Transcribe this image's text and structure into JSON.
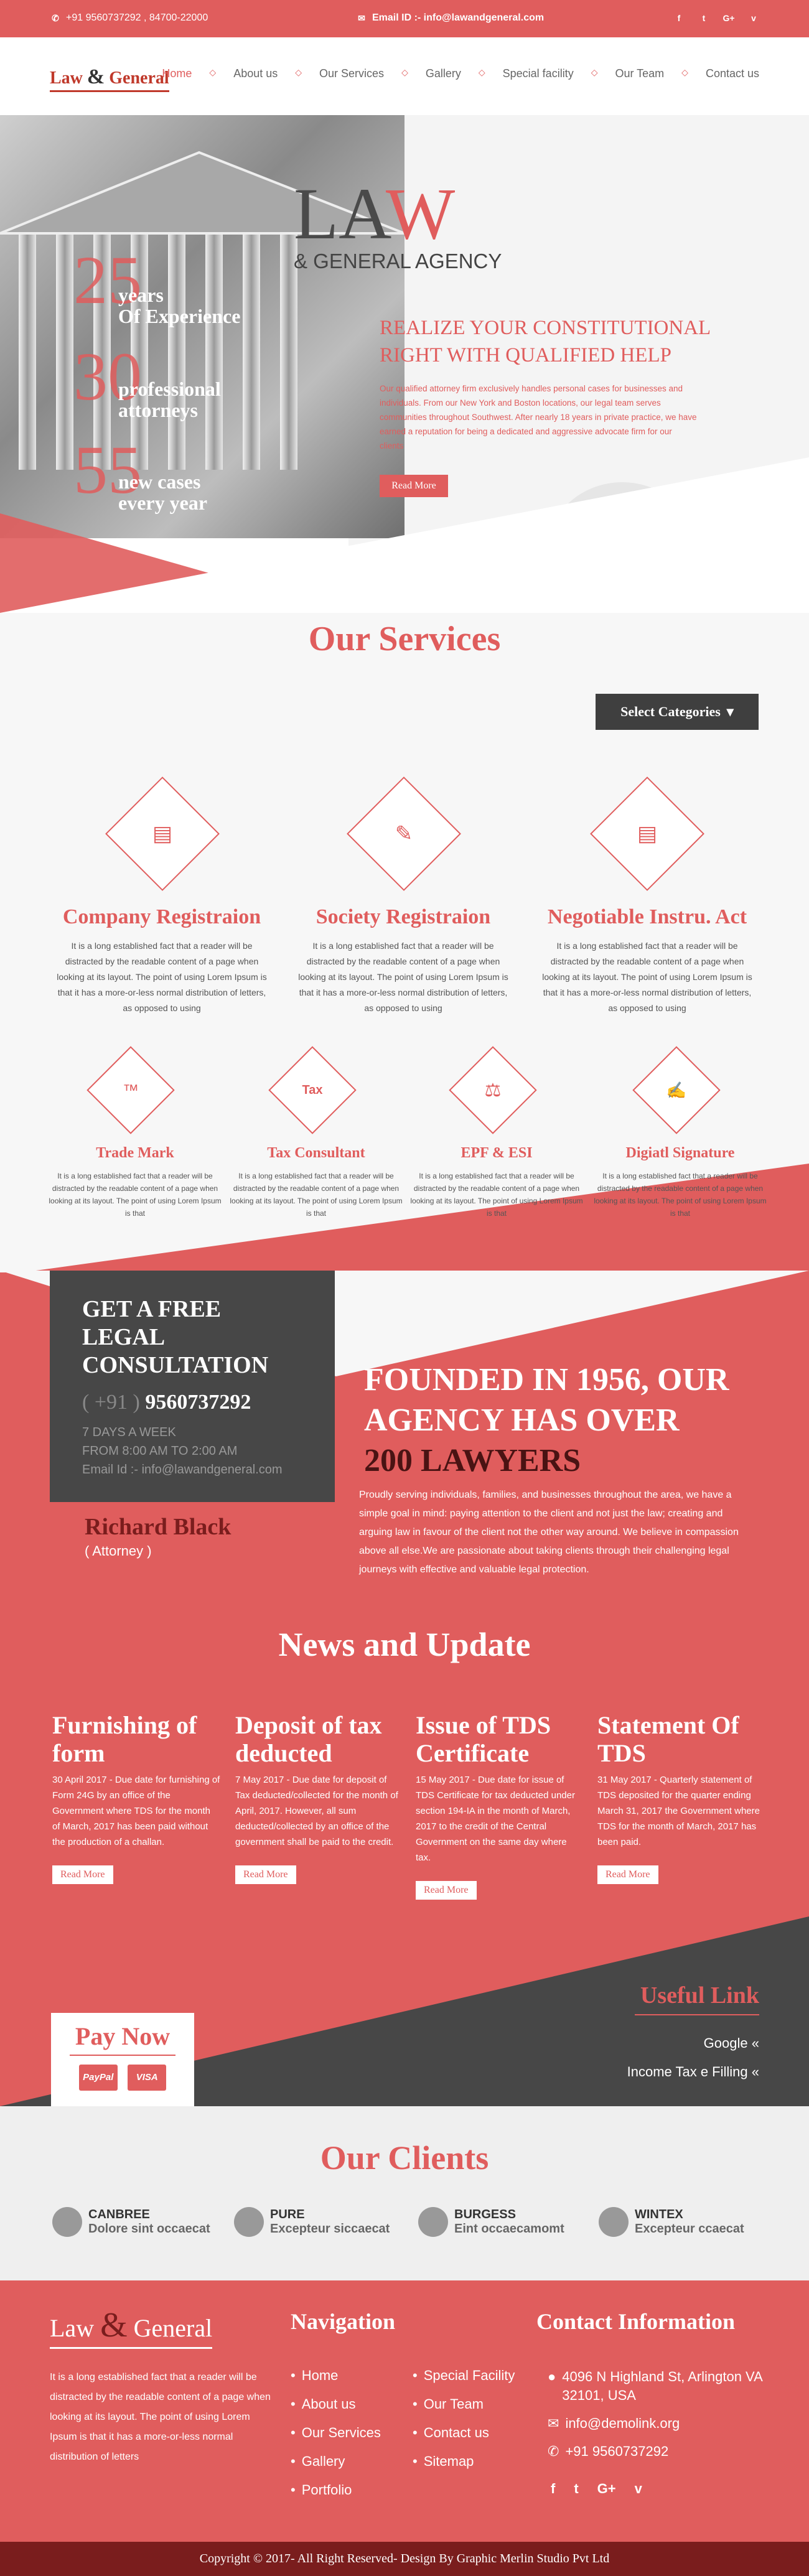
{
  "topbar": {
    "phone": "+91 9560737292 , 84700-22000",
    "email": "Email ID :- info@lawandgeneral.com",
    "social": [
      "f",
      "t",
      "G+",
      "v"
    ]
  },
  "nav": {
    "logo_left": "Law",
    "logo_amp": "&",
    "logo_right": "General",
    "items": [
      "Home",
      "About us",
      "Our Services",
      "Gallery",
      "Special facility",
      "Our Team",
      "Contact us"
    ]
  },
  "hero": {
    "title_law_1": "LA",
    "title_law_2": "W",
    "subtitle": "& GENERAL AGENCY",
    "stats": [
      {
        "num": "25",
        "text1": "years",
        "text2": "Of Experience"
      },
      {
        "num": "30",
        "text1": "professional",
        "text2": "attorneys"
      },
      {
        "num": "55",
        "text1": "new cases",
        "text2": "every year"
      }
    ],
    "headline": "REALIZE YOUR CONSTITUTIONAL RIGHT WITH QUALIFIED HELP",
    "paragraph": "Our qualified attorney firm exclusively handles personal cases for businesses and individuals. From our New York and Boston locations, our legal team serves communities throughout Southwest. After nearly 18 years in private practice, we have earned a reputation for being a dedicated and aggressive advocate firm for our clients",
    "button": "Read More"
  },
  "services": {
    "title": "Our Services",
    "select_label": "Select Categories",
    "big": [
      {
        "title": "Company Registraion",
        "desc": "It is a long established fact that a reader will be distracted by the readable content of a page when looking at its layout. The point of using Lorem Ipsum is that it has a more-or-less normal distribution of letters, as opposed to using",
        "icon": "document-icon"
      },
      {
        "title": "Society Registraion",
        "desc": "It is a long established fact that a reader will be distracted by the readable content of a page when looking at its layout. The point of using Lorem Ipsum is that it has a more-or-less normal distribution of letters, as opposed to using",
        "icon": "certificate-icon"
      },
      {
        "title": "Negotiable Instru. Act",
        "desc": "It is a long established fact that a reader will be distracted by the readable content of a page when looking at its layout. The point of using Lorem Ipsum is that it has a more-or-less normal distribution of letters, as opposed to using",
        "icon": "chart-search-icon"
      }
    ],
    "small": [
      {
        "title": "Trade Mark",
        "desc": "It is a long established fact that a reader will be distracted by the readable content of a page when looking at its layout. The point of using Lorem Ipsum is that",
        "icon": "trademark-icon"
      },
      {
        "title": "Tax Consultant",
        "desc": "It is a long established fact that a reader will be distracted by the readable content of a page when looking at its layout. The point of using Lorem Ipsum is that",
        "icon": "tax-icon"
      },
      {
        "title": "EPF & ESI",
        "desc": "It is a long established fact that a reader will be distracted by the readable content of a page when looking at its layout. The point of using Lorem Ipsum is that",
        "icon": "scales-icon"
      },
      {
        "title": "Digiatl Signature",
        "desc": "It is a long established fact that a reader will be distracted by the readable content of a page when looking at its layout. The point of using Lorem Ipsum is that",
        "icon": "signature-icon"
      }
    ]
  },
  "consult": {
    "heading": "GET A FREE LEGAL CONSULTATION",
    "phone_prefix": "( +91 )",
    "phone": "9560737292",
    "days": "7 DAYS A WEEK",
    "hours": "FROM 8:00 AM TO 2:00 AM",
    "email": "Email Id :- info@lawandgeneral.com",
    "attorney_name": "Richard Black",
    "attorney_role": "( Attorney )"
  },
  "founded": {
    "line1": "FOUNDED IN 1956, OUR AGENCY HAS OVER",
    "line2": "200 LAWYERS",
    "desc": "Proudly serving individuals, families, and businesses throughout the area, we have a simple goal in mind: paying attention to the client and not just the law; creating and arguing law in favour of the client not the other way around. We believe in compassion above all else.We are passionate about taking clients through their challenging legal journeys with effective and valuable legal protection."
  },
  "news": {
    "title": "News and Update",
    "items": [
      {
        "title": "Furnishing of form",
        "text": "30 April 2017 - Due date for furnishing of Form 24G by an office of the Government where TDS for the month of March, 2017 has been paid without the production of a challan.",
        "button": "Read More"
      },
      {
        "title": "Deposit of tax deducted",
        "text": "7 May 2017 - Due date for deposit of Tax deducted/collected for the month of April, 2017. However, all sum deducted/collected by an office of the government shall be paid to the credit.",
        "button": "Read More"
      },
      {
        "title": "Issue of TDS Certificate",
        "text": "15 May 2017 - Due date for issue of TDS Certificate for tax deducted under section 194-IA in the month of March, 2017 to the credit of the Central Government on the same day where tax.",
        "button": "Read More"
      },
      {
        "title": "Statement Of TDS",
        "text": "31 May 2017 - Quarterly statement of TDS deposited for the quarter ending March 31, 2017 the Government where TDS for the month of March, 2017 has been paid.",
        "button": "Read More"
      }
    ]
  },
  "pay": {
    "title": "Pay Now",
    "cards": [
      "PayPal",
      "VISA"
    ]
  },
  "useful": {
    "title": "Useful Link",
    "links": [
      "Google",
      "Income Tax e Filling"
    ]
  },
  "clients": {
    "title": "Our Clients",
    "items": [
      {
        "name": "CANBREE",
        "sub": "Dolore sint occaecat"
      },
      {
        "name": "PURE",
        "sub": "Excepteur siccaecat"
      },
      {
        "name": "BURGESS",
        "sub": "Eint occaecamomt"
      },
      {
        "name": "WINTEX",
        "sub": "Excepteur ccaecat"
      }
    ]
  },
  "footer": {
    "logo_left": "Law",
    "logo_amp": "&",
    "logo_right": "General",
    "text": "It is a long established fact that a reader will be distracted by the readable content of a page when looking at its layout. The point of using Lorem Ipsum is that it has a more-or-less normal distribution of letters",
    "nav_title": "Navigation",
    "nav_col1": [
      "Home",
      "About us",
      "Our Services",
      "Gallery",
      "Portfolio"
    ],
    "nav_col2": [
      "Special Facility",
      "Our Team",
      "Contact us",
      "Sitemap"
    ],
    "contact_title": "Contact Information",
    "address": "4096 N Highland St, Arlington VA 32101, USA",
    "email": "info@demolink.org",
    "phone": "+91 9560737292",
    "social": [
      "f",
      "t",
      "G+",
      "v"
    ],
    "copyright": "Copyright © 2017- All Right Reserved- Design By Graphic Merlin Studio Pvt Ltd"
  },
  "colors": {
    "accent": "#e05d5d",
    "dark": "#474747",
    "maroon": "#7a1d1d"
  }
}
